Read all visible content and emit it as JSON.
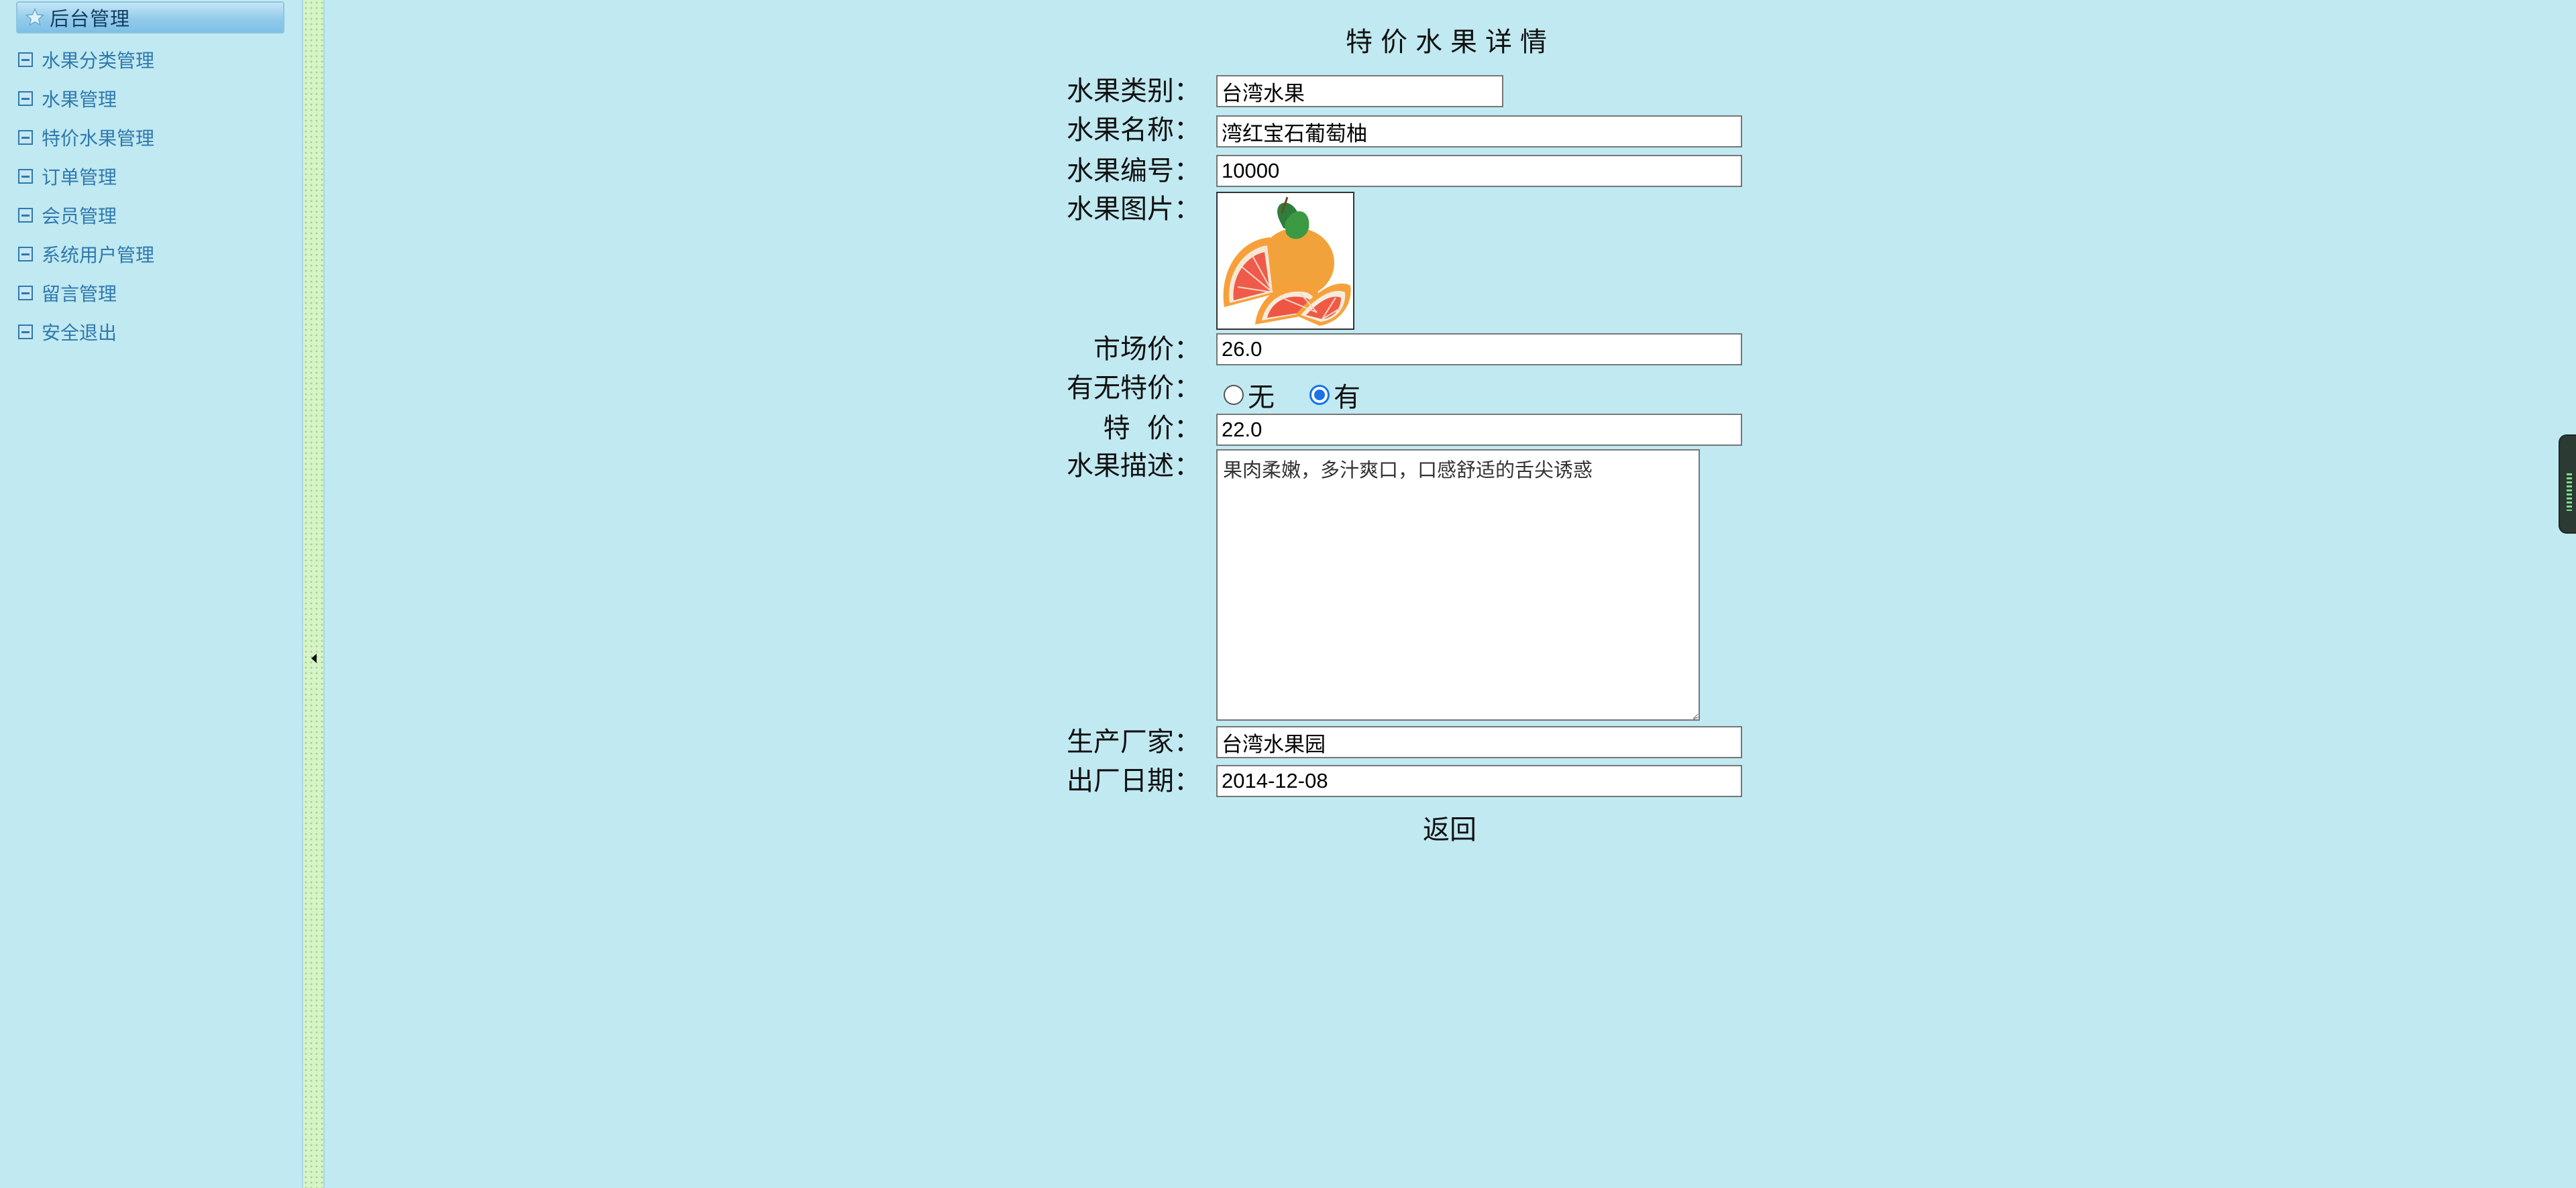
{
  "sidebar": {
    "header": "后台管理",
    "items": [
      {
        "label": "水果分类管理"
      },
      {
        "label": "水果管理"
      },
      {
        "label": "特价水果管理"
      },
      {
        "label": "订单管理"
      },
      {
        "label": "会员管理"
      },
      {
        "label": "系统用户管理"
      },
      {
        "label": "留言管理"
      },
      {
        "label": "安全退出"
      }
    ]
  },
  "page": {
    "title": "特价水果详情",
    "back_label": "返回"
  },
  "form": {
    "category": {
      "label": "水果类别：",
      "value": "台湾水果"
    },
    "name": {
      "label": "水果名称：",
      "value": "湾红宝石葡萄柚"
    },
    "code": {
      "label": "水果编号：",
      "value": "10000"
    },
    "image": {
      "label": "水果图片：",
      "alt": "grapefruit"
    },
    "market_price": {
      "label": "市场价：",
      "value": "26.0"
    },
    "special": {
      "label": "有无特价：",
      "options": [
        {
          "label": "无",
          "checked": false
        },
        {
          "label": "有",
          "checked": true
        }
      ]
    },
    "special_price": {
      "label": "特  价：",
      "value": "22.0"
    },
    "description": {
      "label": "水果描述：",
      "value": "果肉柔嫩，多汁爽口，口感舒适的舌尖诱惑"
    },
    "manufacturer": {
      "label": "生产厂家：",
      "value": "台湾水果园"
    },
    "date": {
      "label": "出厂日期：",
      "value": "2014-12-08"
    }
  },
  "colors": {
    "background": "#c1e9f1",
    "sidebar_text": "#2f79ae",
    "radio_accent": "#1a73e8"
  },
  "icons": {
    "sidebar_header": "star-icon",
    "sidebar_item": "list-bullet-icon",
    "splitter": "collapse-left-arrow-icon",
    "side_widget": "floating-tool-icon"
  }
}
